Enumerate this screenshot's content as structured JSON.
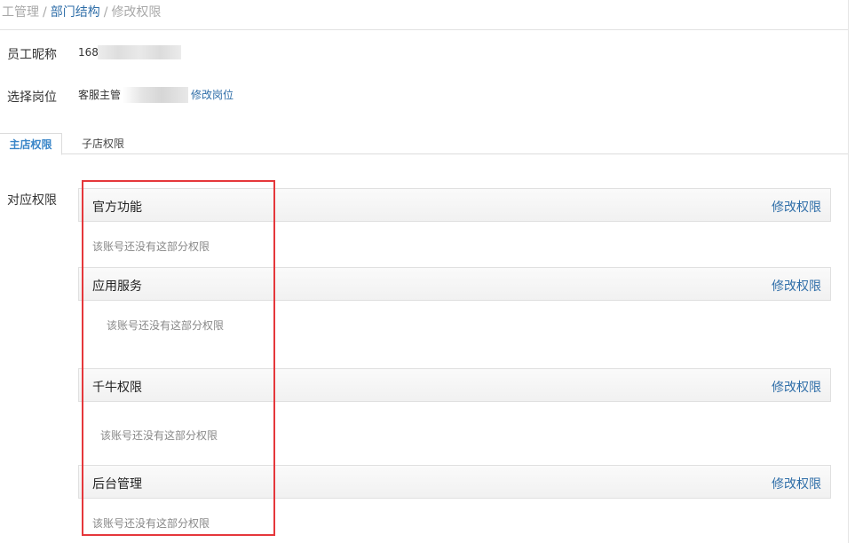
{
  "breadcrumb": {
    "item1": "工管理",
    "item2": "部门结构",
    "item3": "修改权限",
    "separator": "/"
  },
  "employee": {
    "nickname_label": "员工昵称",
    "nickname_value": "168",
    "position_label": "选择岗位",
    "position_value": "客服主管",
    "edit_position": "修改岗位"
  },
  "tabs": [
    {
      "label": "主店权限",
      "active": true
    },
    {
      "label": "子店权限",
      "active": false
    }
  ],
  "permissions": {
    "label": "对应权限",
    "sections": [
      {
        "title": "官方功能",
        "edit_label": "修改权限",
        "empty_text": "该账号还没有这部分权限"
      },
      {
        "title": "应用服务",
        "edit_label": "修改权限",
        "empty_text": "该账号还没有这部分权限"
      },
      {
        "title": "千牛权限",
        "edit_label": "修改权限",
        "empty_text": "该账号还没有这部分权限"
      },
      {
        "title": "后台管理",
        "edit_label": "修改权限",
        "empty_text": "该账号还没有这部分权限"
      }
    ]
  },
  "colors": {
    "link": "#2f6ea8",
    "active_tab": "#3a86c8",
    "highlight": "#e5373b",
    "muted_text": "#888888"
  }
}
